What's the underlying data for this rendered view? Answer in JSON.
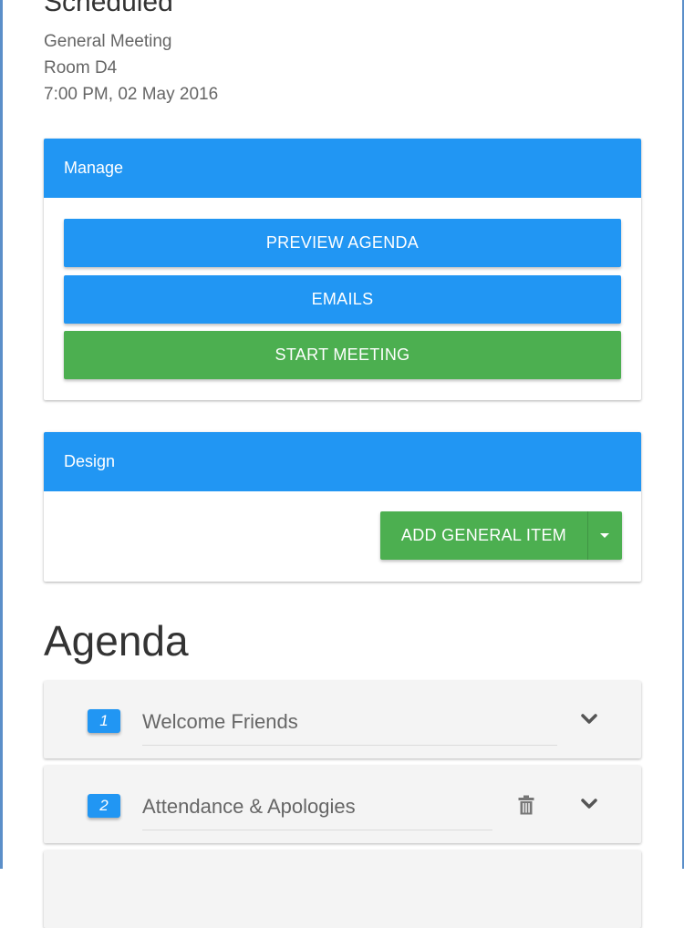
{
  "heading": {
    "partial": "Scheduled"
  },
  "meeting": {
    "type": "General Meeting",
    "room": "Room D4",
    "datetime": "7:00 PM, 02 May 2016"
  },
  "manage": {
    "title": "Manage",
    "preview_label": "PREVIEW AGENDA",
    "emails_label": "EMAILS",
    "start_label": "START MEETING"
  },
  "design": {
    "title": "Design",
    "add_item_label": "ADD GENERAL ITEM",
    "dropdown_icon": "caret-down-icon"
  },
  "agenda": {
    "title": "Agenda",
    "items": [
      {
        "number": "1",
        "title": "Welcome Friends",
        "deletable": false
      },
      {
        "number": "2",
        "title": "Attendance & Apologies",
        "deletable": true
      }
    ]
  },
  "colors": {
    "primary": "#2196f3",
    "success": "#4caf50",
    "card_bg": "#f4f4f4",
    "window_border": "#5b8fc9"
  }
}
